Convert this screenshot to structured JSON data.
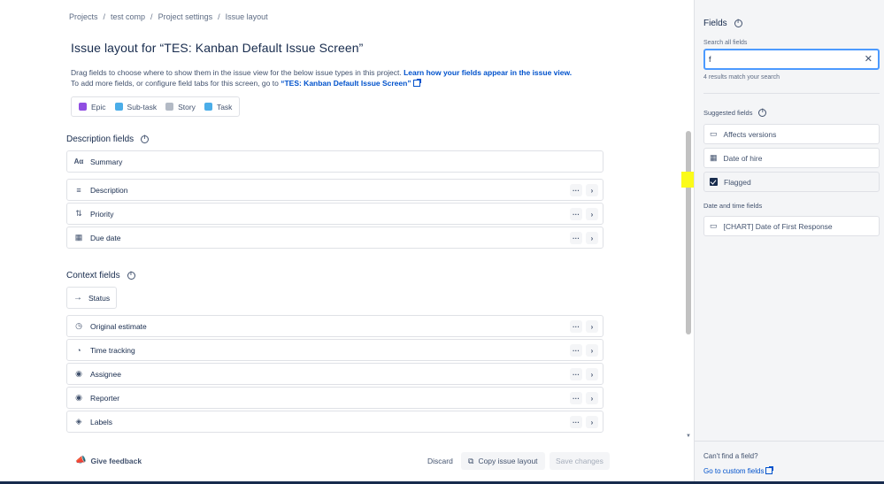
{
  "breadcrumb": [
    "Projects",
    "test comp",
    "Project settings",
    "Issue layout"
  ],
  "title": "Issue layout for “TES: Kanban Default Issue Screen”",
  "description": {
    "line1_text": "Drag fields to choose where to show them in the issue view for the below issue types in this project.",
    "line1_link": "Learn how your fields appear in the issue view.",
    "line2_text": "To add more fields, or configure field tabs for this screen, go to",
    "line2_link": "“TES: Kanban Default Issue Screen”"
  },
  "issue_types": [
    {
      "label": "Epic",
      "icon": "epic-icon",
      "color": "#904ee2"
    },
    {
      "label": "Sub-task",
      "icon": "subtask-icon",
      "color": "#4bade8"
    },
    {
      "label": "Story",
      "icon": "story-icon",
      "color": "#b3bac5"
    },
    {
      "label": "Task",
      "icon": "task-icon",
      "color": "#4bade8"
    }
  ],
  "description_section": {
    "title": "Description fields",
    "summary": "Summary",
    "fields": [
      "Description",
      "Priority",
      "Due date"
    ]
  },
  "context_section": {
    "title": "Context fields",
    "status": "Status",
    "fields": [
      "Original estimate",
      "Time tracking",
      "Assignee",
      "Reporter",
      "Labels"
    ]
  },
  "footer": {
    "feedback": "Give feedback",
    "discard": "Discard",
    "copy": "Copy issue layout",
    "save": "Save changes"
  },
  "panel": {
    "title": "Fields",
    "search_label": "Search all fields",
    "search_value": "f",
    "match_text": "4 results match your search",
    "suggested_title": "Suggested fields",
    "suggested": [
      "Affects versions",
      "Date of hire",
      "Flagged"
    ],
    "datetime_title": "Date and time fields",
    "datetime": [
      "[CHART] Date of First Response"
    ],
    "cant_find": "Can't find a field?",
    "custom_link": "Go to custom fields"
  },
  "colors": {
    "accent": "#0052cc",
    "highlight": "#fbfb19",
    "focus": "#4c9aff"
  }
}
